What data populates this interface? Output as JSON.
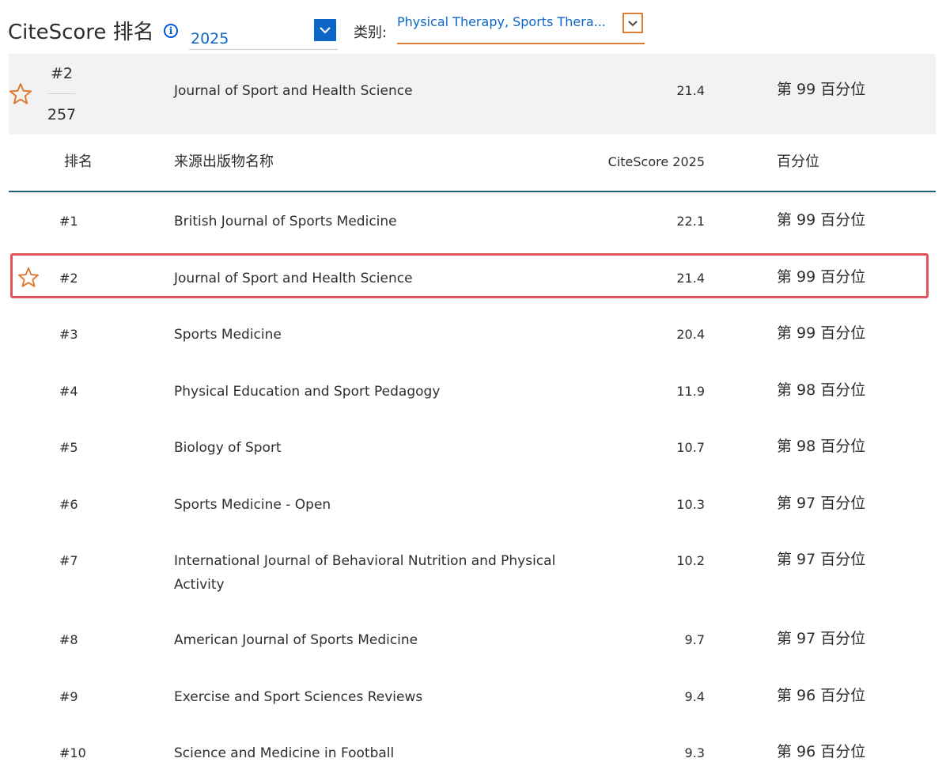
{
  "header": {
    "title": "CiteScore 排名",
    "info_icon": "i",
    "year": "2025",
    "category_label": "类别:",
    "category_value": "Physical Therapy, Sports Thera..."
  },
  "summary": {
    "rank": "#2",
    "total": "257",
    "title": "Journal of Sport and Health Science",
    "score": "21.4",
    "percentile": "第 99 百分位"
  },
  "table": {
    "headers": {
      "rank": "排名",
      "title": "来源出版物名称",
      "score": "CiteScore 2025",
      "percentile": "百分位"
    },
    "rows": [
      {
        "rank": "#1",
        "title": "British Journal of Sports Medicine",
        "score": "22.1",
        "percentile": "第 99 百分位",
        "starred": false
      },
      {
        "rank": "#2",
        "title": "Journal of Sport and Health Science",
        "score": "21.4",
        "percentile": "第 99 百分位",
        "starred": true
      },
      {
        "rank": "#3",
        "title": "Sports Medicine",
        "score": "20.4",
        "percentile": "第 99 百分位",
        "starred": false
      },
      {
        "rank": "#4",
        "title": "Physical Education and Sport Pedagogy",
        "score": "11.9",
        "percentile": "第 98 百分位",
        "starred": false
      },
      {
        "rank": "#5",
        "title": "Biology of Sport",
        "score": "10.7",
        "percentile": "第 98 百分位",
        "starred": false
      },
      {
        "rank": "#6",
        "title": "Sports Medicine - Open",
        "score": "10.3",
        "percentile": "第 97 百分位",
        "starred": false
      },
      {
        "rank": "#7",
        "title": "International Journal of Behavioral Nutrition and Physical Activity",
        "score": "10.2",
        "percentile": "第 97 百分位",
        "starred": false
      },
      {
        "rank": "#8",
        "title": "American Journal of Sports Medicine",
        "score": "9.7",
        "percentile": "第 97 百分位",
        "starred": false
      },
      {
        "rank": "#9",
        "title": "Exercise and Sport Sciences Reviews",
        "score": "9.4",
        "percentile": "第 96 百分位",
        "starred": false
      },
      {
        "rank": "#10",
        "title": "Science and Medicine in Football",
        "score": "9.3",
        "percentile": "第 96 百分位",
        "starred": false
      }
    ]
  },
  "colors": {
    "accent_blue": "#0c66c8",
    "accent_orange": "#e07a2f",
    "highlight_red": "#e4535a",
    "header_rule": "#1f5f7a"
  },
  "icons": {
    "info": "info-icon",
    "year_toggle": "chevron-down-icon",
    "category_toggle": "chevron-down-icon",
    "star": "star-outline-icon"
  }
}
